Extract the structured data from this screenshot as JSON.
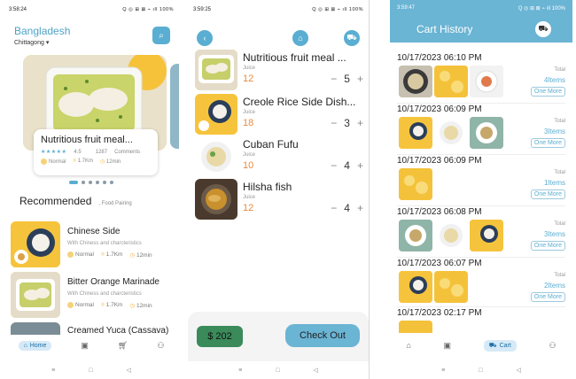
{
  "screen1": {
    "status": {
      "time": "3:58:24",
      "icons": "Q ◎ ⊞ ⊠ ⌁ ıll 100%"
    },
    "country": "Bangladesh",
    "city": "Chittagong",
    "featured": {
      "title": "Nutritious fruit meal...",
      "rating": "4.5",
      "comments_count": "1287",
      "comments_label": "Comments",
      "level": "Normal",
      "distance": "1.7Km",
      "time": "12min"
    },
    "recommended_title": "Recommended",
    "recommended_filter": "Food Pairing",
    "recommended": [
      {
        "name": "Chinese Side",
        "desc": "With Chiness  and charcteristics",
        "level": "Normal",
        "distance": "1.7Km",
        "time": "12min"
      },
      {
        "name": "Bitter Orange Marinade",
        "desc": "With Chiness  and charcteristics",
        "level": "Normal",
        "distance": "1.7Km",
        "time": "12min"
      },
      {
        "name": "Creamed Yuca (Cassava)"
      }
    ],
    "nav": {
      "home": "Home"
    }
  },
  "screen2": {
    "status": {
      "time": "3:59:25",
      "icons": "Q ◎ ⊞ ⊠ ⌁ ıll 100%"
    },
    "items": [
      {
        "name": "Nutritious fruit meal ...",
        "type": "Juice",
        "price": "12",
        "qty": "5"
      },
      {
        "name": "Creole Rice Side Dish...",
        "type": "Juice",
        "price": "18",
        "qty": "3"
      },
      {
        "name": "Cuban Fufu",
        "type": "Juice",
        "price": "10",
        "qty": "4"
      },
      {
        "name": "Hilsha fish",
        "type": "Juice",
        "price": "12",
        "qty": "4"
      }
    ],
    "total": "$ 202",
    "checkout": "Check Out"
  },
  "screen3": {
    "status": {
      "time": "3:59:47",
      "icons": "Q ◎ ⊞ ⊠ ⌁ ıll 100%"
    },
    "title": "Cart History",
    "history": [
      {
        "date": "10/17/2023 06:10 PM",
        "total": "Total",
        "items": "4Items",
        "more": "One More"
      },
      {
        "date": "10/17/2023 06:09 PM",
        "total": "Total",
        "items": "3Items",
        "more": "One More"
      },
      {
        "date": "10/17/2023 06:09 PM",
        "total": "Total",
        "items": "1Items",
        "more": "One More"
      },
      {
        "date": "10/17/2023 06:08 PM",
        "total": "Total",
        "items": "3Items",
        "more": "One More"
      },
      {
        "date": "10/17/2023 06:07 PM",
        "total": "Total",
        "items": "2Items",
        "more": "One More"
      },
      {
        "date": "10/17/2023 02:17 PM"
      }
    ],
    "nav": {
      "cart": "Cart"
    }
  },
  "colors": {
    "accent": "#5aaed1",
    "price": "#e88a3c",
    "total_button": "#3a8a5a",
    "header": "#6ab4d4"
  }
}
